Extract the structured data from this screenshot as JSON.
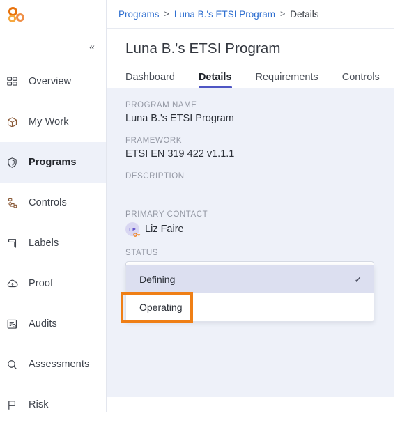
{
  "brand": {
    "logo_name": "three-rings-logo",
    "colors": [
      "#e8720c",
      "#ef8e46",
      "#f6a83f"
    ]
  },
  "sidebar": {
    "collapse_label": "«",
    "items": [
      {
        "label": "Overview",
        "icon": "grid-icon",
        "active": false
      },
      {
        "label": "My Work",
        "icon": "box-icon",
        "active": false
      },
      {
        "label": "Programs",
        "icon": "shield-icon",
        "active": true
      },
      {
        "label": "Controls",
        "icon": "sitemap-icon",
        "active": false
      },
      {
        "label": "Labels",
        "icon": "bookmark-icon",
        "active": false
      },
      {
        "label": "Proof",
        "icon": "cloud-upload-icon",
        "active": false
      },
      {
        "label": "Audits",
        "icon": "document-search-icon",
        "active": false
      },
      {
        "label": "Assessments",
        "icon": "search-icon",
        "active": false
      },
      {
        "label": "Risk",
        "icon": "flag-icon",
        "active": false
      }
    ]
  },
  "breadcrumb": {
    "items": [
      "Programs",
      "Luna B.'s ETSI Program",
      "Details"
    ],
    "separator": ">"
  },
  "header": {
    "title": "Luna B.'s ETSI Program"
  },
  "tabs": [
    {
      "label": "Dashboard",
      "active": false
    },
    {
      "label": "Details",
      "active": true
    },
    {
      "label": "Requirements",
      "active": false
    },
    {
      "label": "Controls",
      "active": false
    }
  ],
  "details": {
    "program_name": {
      "label": "PROGRAM NAME",
      "value": "Luna B.'s ETSI Program"
    },
    "framework": {
      "label": "FRAMEWORK",
      "value": "ETSI EN 319 422 v1.1.1"
    },
    "description": {
      "label": "DESCRIPTION",
      "value": ""
    },
    "primary_contact": {
      "label": "PRIMARY CONTACT",
      "name": "Liz Faire",
      "initials": "LF",
      "badge_icon": "key-icon"
    },
    "status": {
      "label": "STATUS",
      "value": "Defining",
      "options": [
        {
          "label": "Defining",
          "selected": true
        },
        {
          "label": "Operating",
          "selected": false
        }
      ],
      "check_glyph": "✓",
      "highlight_color": "#ef7f16"
    }
  }
}
